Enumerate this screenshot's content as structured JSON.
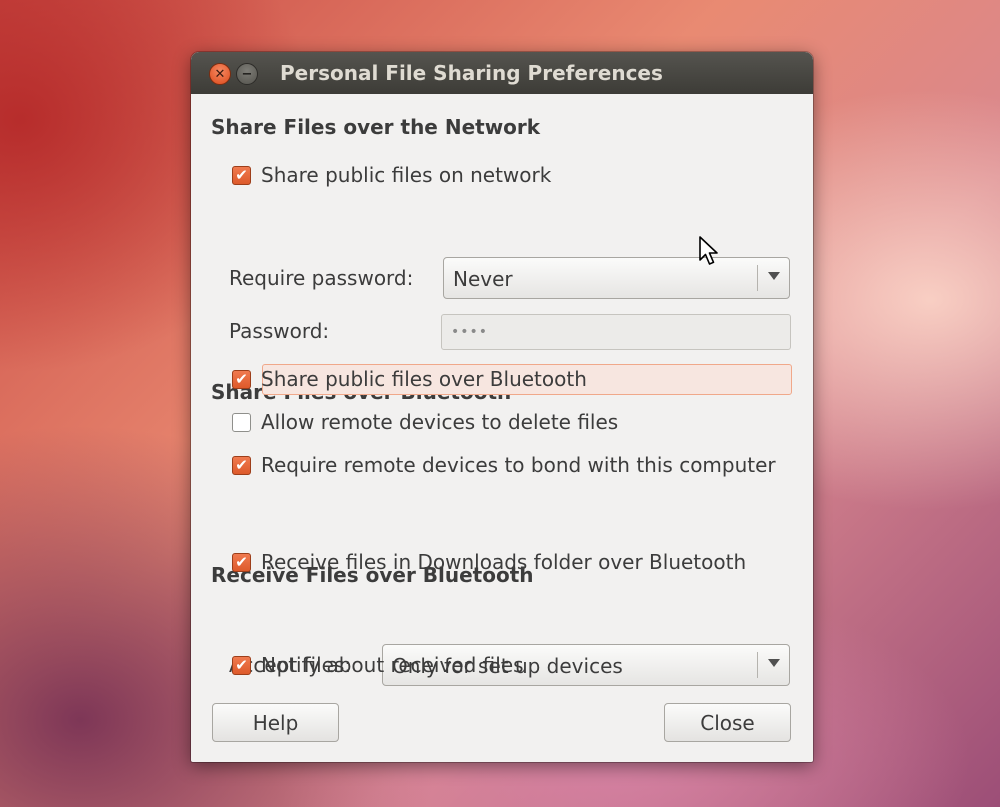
{
  "window": {
    "title": "Personal File Sharing Preferences",
    "close_glyph": "✕",
    "minimize_glyph": "−"
  },
  "network": {
    "section_title": "Share Files over the Network",
    "share_public": {
      "label": "Share public files on network",
      "checked": true
    },
    "require_password_label": "Require password:",
    "require_password_value": "Never",
    "password_label": "Password:",
    "password_value": "••••"
  },
  "bluetooth_share": {
    "section_title": "Share Files over Bluetooth",
    "share_public": {
      "label": "Share public files over Bluetooth",
      "checked": true
    },
    "allow_delete": {
      "label": "Allow remote devices to delete files",
      "checked": false
    },
    "require_bond": {
      "label": "Require remote devices to bond with this computer",
      "checked": true
    }
  },
  "bluetooth_receive": {
    "section_title": "Receive Files over Bluetooth",
    "receive_downloads": {
      "label": "Receive files in Downloads folder over Bluetooth",
      "checked": true
    },
    "accept_files_label": "Accept files:",
    "accept_files_value": "Only for set up devices",
    "notify": {
      "label": "Notify about received files",
      "checked": true
    }
  },
  "buttons": {
    "help": "Help",
    "close": "Close"
  },
  "check_glyph": "✔",
  "colors": {
    "accent": "#e95f2c",
    "titlebar": "#3d3c37",
    "window_bg": "#f2f1f0"
  },
  "icons": {
    "close": "close-icon",
    "minimize": "minimize-icon",
    "dropdown": "chevron-down-icon",
    "cursor": "mouse-pointer-icon"
  }
}
